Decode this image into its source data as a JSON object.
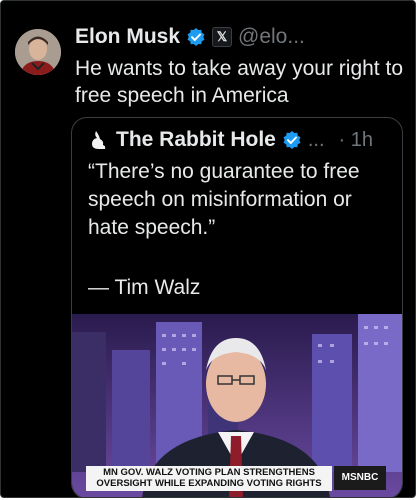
{
  "author": {
    "name": "Elon Musk",
    "handle": "@elo...",
    "affiliate_badge": "𝕏",
    "verified_icon": "verified-badge-icon"
  },
  "tweet": {
    "text": "He wants to take away your right to free speech in America"
  },
  "quoted": {
    "name": "The Rabbit Hole",
    "handle": "...",
    "time": "· 1h",
    "text": "“There’s no guarantee to free speech on misinformation or hate speech.”",
    "attribution": "— Tim Walz",
    "media": {
      "chyron": "MN GOV. WALZ VOTING PLAN STRENGTHENS OVERSIGHT WHILE EXPANDING VOTING RIGHTS",
      "network_logo": "MSNBC"
    }
  },
  "colors": {
    "background": "#000000",
    "text_primary": "#e7e9ea",
    "text_secondary": "#71767b",
    "verified_blue": "#1d9bf0",
    "border": "#2f3336"
  }
}
